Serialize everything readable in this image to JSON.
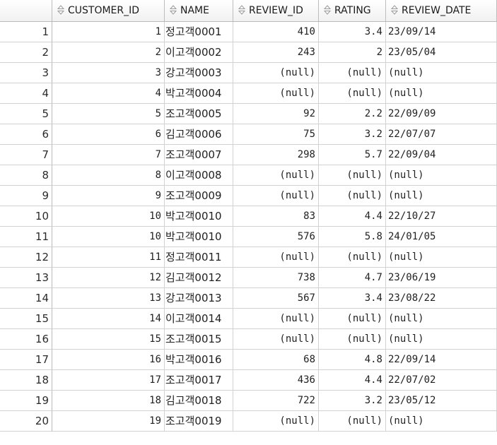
{
  "grid": {
    "headers": [
      {
        "key": "rownum",
        "label": ""
      },
      {
        "key": "customer_id",
        "label": "CUSTOMER_ID"
      },
      {
        "key": "name",
        "label": "NAME"
      },
      {
        "key": "review_id",
        "label": "REVIEW_ID"
      },
      {
        "key": "rating",
        "label": "RATING"
      },
      {
        "key": "review_date",
        "label": "REVIEW_DATE"
      }
    ],
    "sort_icon": "sort-arrows-icon",
    "rows": [
      {
        "rownum": "1",
        "customer_id": "1",
        "name": "정고객0001",
        "review_id": "410",
        "rating": "3.4",
        "review_date": "23/09/14"
      },
      {
        "rownum": "2",
        "customer_id": "2",
        "name": "이고객0002",
        "review_id": "243",
        "rating": "2",
        "review_date": "23/05/04"
      },
      {
        "rownum": "3",
        "customer_id": "3",
        "name": "강고객0003",
        "review_id": "(null)",
        "rating": "(null)",
        "review_date": "(null)"
      },
      {
        "rownum": "4",
        "customer_id": "4",
        "name": "박고객0004",
        "review_id": "(null)",
        "rating": "(null)",
        "review_date": "(null)"
      },
      {
        "rownum": "5",
        "customer_id": "5",
        "name": "조고객0005",
        "review_id": "92",
        "rating": "2.2",
        "review_date": "22/09/09"
      },
      {
        "rownum": "6",
        "customer_id": "6",
        "name": "김고객0006",
        "review_id": "75",
        "rating": "3.2",
        "review_date": "22/07/07"
      },
      {
        "rownum": "7",
        "customer_id": "7",
        "name": "조고객0007",
        "review_id": "298",
        "rating": "5.7",
        "review_date": "22/09/04"
      },
      {
        "rownum": "8",
        "customer_id": "8",
        "name": "이고객0008",
        "review_id": "(null)",
        "rating": "(null)",
        "review_date": "(null)"
      },
      {
        "rownum": "9",
        "customer_id": "9",
        "name": "조고객0009",
        "review_id": "(null)",
        "rating": "(null)",
        "review_date": "(null)"
      },
      {
        "rownum": "10",
        "customer_id": "10",
        "name": "박고객0010",
        "review_id": "83",
        "rating": "4.4",
        "review_date": "22/10/27"
      },
      {
        "rownum": "11",
        "customer_id": "10",
        "name": "박고객0010",
        "review_id": "576",
        "rating": "5.8",
        "review_date": "24/01/05"
      },
      {
        "rownum": "12",
        "customer_id": "11",
        "name": "정고객0011",
        "review_id": "(null)",
        "rating": "(null)",
        "review_date": "(null)"
      },
      {
        "rownum": "13",
        "customer_id": "12",
        "name": "김고객0012",
        "review_id": "738",
        "rating": "4.7",
        "review_date": "23/06/19"
      },
      {
        "rownum": "14",
        "customer_id": "13",
        "name": "강고객0013",
        "review_id": "567",
        "rating": "3.4",
        "review_date": "23/08/22"
      },
      {
        "rownum": "15",
        "customer_id": "14",
        "name": "이고객0014",
        "review_id": "(null)",
        "rating": "(null)",
        "review_date": "(null)"
      },
      {
        "rownum": "16",
        "customer_id": "15",
        "name": "조고객0015",
        "review_id": "(null)",
        "rating": "(null)",
        "review_date": "(null)"
      },
      {
        "rownum": "17",
        "customer_id": "16",
        "name": "박고객0016",
        "review_id": "68",
        "rating": "4.8",
        "review_date": "22/09/14"
      },
      {
        "rownum": "18",
        "customer_id": "17",
        "name": "조고객0017",
        "review_id": "436",
        "rating": "4.4",
        "review_date": "22/07/02"
      },
      {
        "rownum": "19",
        "customer_id": "18",
        "name": "김고객0018",
        "review_id": "722",
        "rating": "3.2",
        "review_date": "23/05/12"
      },
      {
        "rownum": "20",
        "customer_id": "19",
        "name": "조고객0019",
        "review_id": "(null)",
        "rating": "(null)",
        "review_date": "(null)"
      }
    ]
  }
}
